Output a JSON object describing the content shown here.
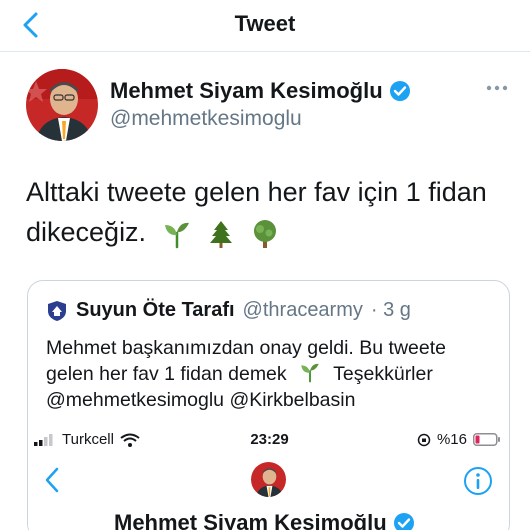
{
  "header": {
    "title": "Tweet"
  },
  "author": {
    "name": "Mehmet Siyam Kesimoğlu",
    "handle": "@mehmetkesimoglu"
  },
  "tweet": {
    "text_line1": "Alttaki tweete gelen her fav için 1 fidan",
    "text_line2": "dikeceğiz."
  },
  "icons": {
    "back": "chevron-left-icon",
    "verified": "verified-badge-icon",
    "more": "more-horizontal-icon",
    "emoji": [
      "seedling-emoji",
      "evergreen-tree-emoji",
      "deciduous-tree-emoji"
    ]
  },
  "quote": {
    "name": "Suyun Öte Tarafı",
    "handle": "@thracearmy",
    "time": "· 3 g",
    "line1": "Mehmet başkanımızdan onay geldi. Bu tweete",
    "line2": "gelen her fav 1 fidan demek",
    "line2_tail": "Teşekkürler",
    "line3": "@mehmetkesimoglu @Kirkbelbasin"
  },
  "screenshot": {
    "carrier": "Turkcell",
    "time": "23:29",
    "battery": "%16",
    "name": "Mehmet Siyam Kesimoğlu"
  },
  "colors": {
    "accent": "#1da1f2",
    "text": "#14171a",
    "muted": "#657786",
    "border": "#e1e8ed",
    "battery_low": "#e0245e"
  }
}
